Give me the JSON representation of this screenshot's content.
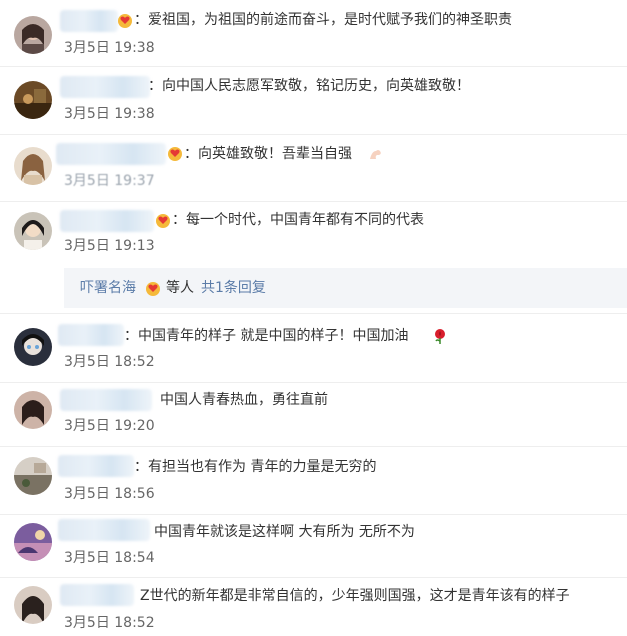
{
  "comments": [
    {
      "text": "：爱祖国，为祖国的前途而奋斗，是时代赋予我们的神圣职责",
      "time": "3月5日 19:38"
    },
    {
      "text": "：向中国人民志愿军致敬，铭记历史，向英雄致敬！",
      "time": "3月5日 19:38"
    },
    {
      "text": "：向英雄致敬！吾辈当自强",
      "time": "3月5日 19:37"
    },
    {
      "text": "：每一个时代，中国青年都有不同的代表",
      "time": "3月5日 19:13"
    },
    {
      "text": "：中国青年的样子 就是中国的样子！中国加油",
      "time": "3月5日 18:52"
    },
    {
      "text": "中国人青春热血，勇往直前",
      "time": "3月5日 19:20"
    },
    {
      "text": "：有担当也有作为 青年的力量是无穷的",
      "time": "3月5日 18:56"
    },
    {
      "text": "中国青年就该是这样啊 大有所为 无所不为",
      "time": "3月5日 18:54"
    },
    {
      "text": "Z世代的新年都是非常自信的，少年强则国强，这才是青年该有的样子",
      "time": "3月5日 18:52"
    }
  ],
  "reply": {
    "name": "吓署名海",
    "etc": "等人",
    "link": "共1条回复"
  },
  "icons": {
    "badge": "heart-hands-icon",
    "flex": "flexed-arm-icon",
    "rose": "rose-icon"
  },
  "colors": {
    "link": "#5b7ca8",
    "reply_bg": "#f3f5f8",
    "text": "#333333",
    "time": "#666666"
  }
}
